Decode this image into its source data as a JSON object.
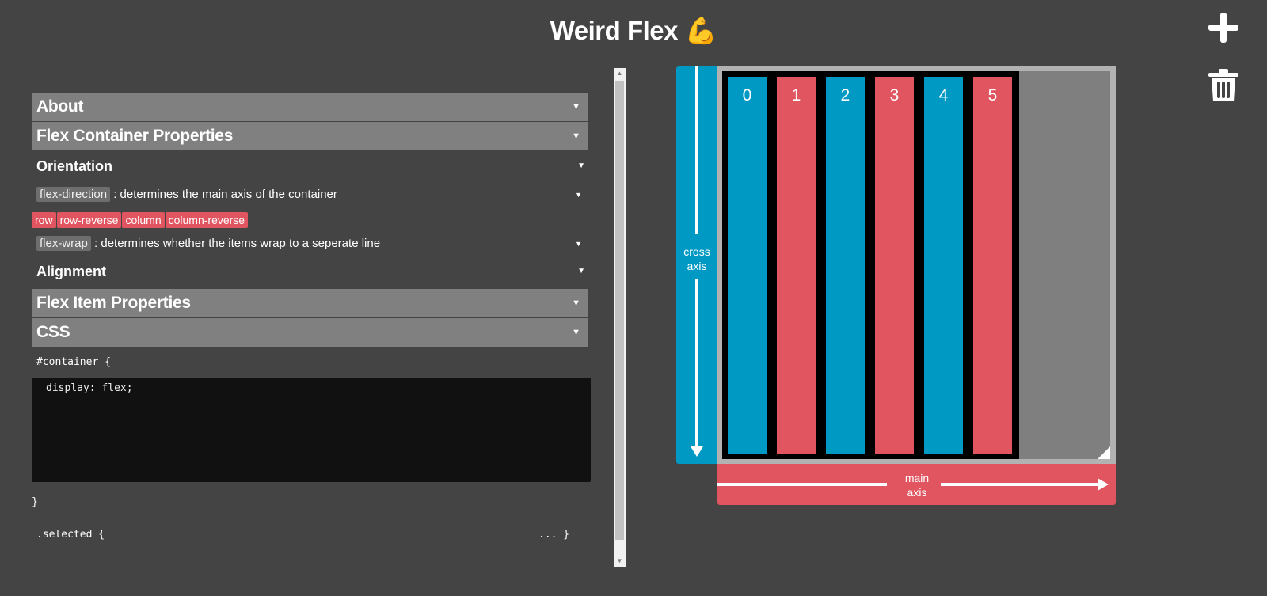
{
  "app": {
    "title": "Weird Flex",
    "title_emoji": "💪"
  },
  "toolbar": {
    "add_icon": "plus-icon",
    "trash_icon": "trash-icon"
  },
  "sections": {
    "about": "About",
    "flex_container": "Flex Container Properties",
    "orientation": "Orientation",
    "flex_direction": {
      "tag": "flex-direction",
      "desc": ": determines the main axis of the container",
      "options": [
        "row",
        "row-reverse",
        "column",
        "column-reverse"
      ]
    },
    "flex_wrap": {
      "tag": "flex-wrap",
      "desc": ": determines whether the items wrap to a seperate line"
    },
    "alignment": "Alignment",
    "flex_item": "Flex Item Properties",
    "css": "CSS"
  },
  "css_editor": {
    "container_open": "#container {",
    "content": "display: flex;",
    "container_close": "}",
    "selected_open": ".selected {",
    "selected_collapsed": "... }"
  },
  "demo": {
    "cross_axis_label": [
      "cross",
      "axis"
    ],
    "main_axis_label": [
      "main",
      "axis"
    ],
    "items": [
      {
        "label": "0",
        "color": "#0099c4"
      },
      {
        "label": "1",
        "color": "#e05560"
      },
      {
        "label": "2",
        "color": "#0099c4"
      },
      {
        "label": "3",
        "color": "#e05560"
      },
      {
        "label": "4",
        "color": "#0099c4"
      },
      {
        "label": "5",
        "color": "#e05560"
      }
    ]
  },
  "colors": {
    "background": "#444444",
    "blue": "#0099c4",
    "red": "#e05560",
    "section": "#808080"
  }
}
